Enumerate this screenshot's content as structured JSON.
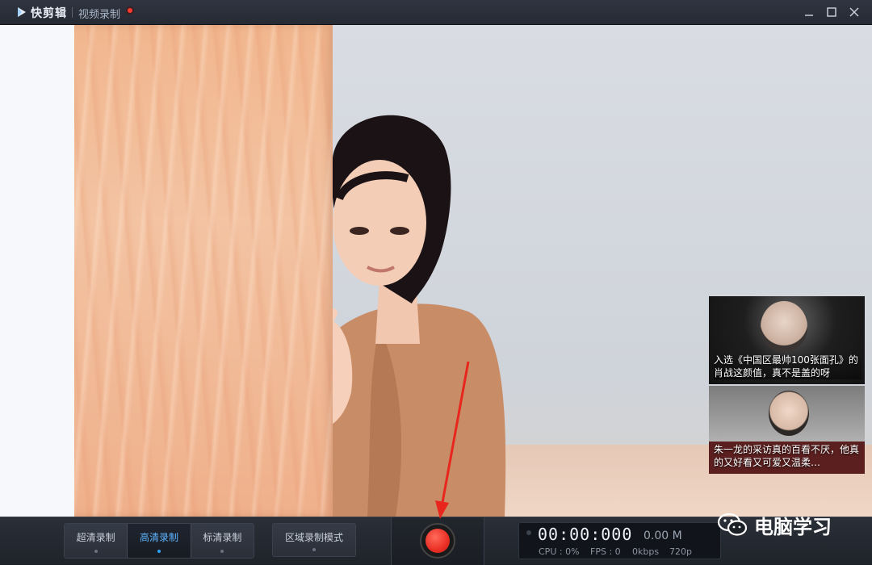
{
  "titlebar": {
    "app_name": "快剪辑",
    "mode_title": "视频录制",
    "icons": {
      "logo": "play-logo-icon",
      "minimize": "minimize-icon",
      "maximize": "maximize-icon",
      "close": "close-icon"
    }
  },
  "preview": {
    "thumbnails": [
      {
        "caption": "入选《中国区最帅100张面孔》的肖战这颜值，真不是盖的呀"
      },
      {
        "caption": "朱一龙的采访真的百看不厌，他真的又好看又可爱又温柔…"
      }
    ]
  },
  "controls": {
    "quality_modes": [
      {
        "label": "超清录制",
        "active": false
      },
      {
        "label": "高清录制",
        "active": true
      },
      {
        "label": "标清录制",
        "active": false
      }
    ],
    "region_mode_label": "区域录制模式",
    "record_icon": "record-icon",
    "timer": "00:00:000",
    "file_size": "0.00 M",
    "cpu": "CPU : 0%",
    "fps": "FPS : 0",
    "bitrate": "0kbps",
    "resolution": "720p"
  },
  "watermark": {
    "text": "电脑学习",
    "icon": "wechat-icon"
  },
  "colors": {
    "accent": "#2ea2ff",
    "record": "#ea2f25",
    "titlebar": "#2c313b"
  }
}
